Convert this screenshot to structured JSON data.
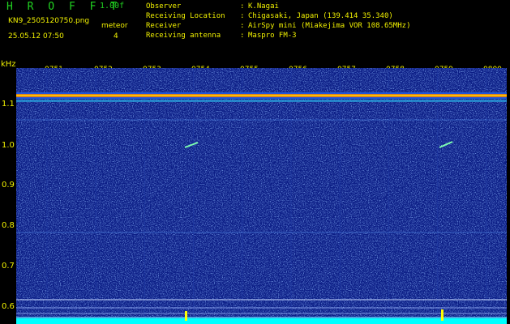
{
  "header": {
    "brand": "H R O F F T",
    "version": "1.00f",
    "filename": "KN9_2505120750.png",
    "datetime": "25.05.12 07:50",
    "meteor_label": "meteor",
    "meteor_count": "4"
  },
  "info": [
    {
      "key": "Observer",
      "sep": ":",
      "value": "K.Nagai"
    },
    {
      "key": "Receiving Location",
      "sep": ":",
      "value": "Chigasaki, Japan (139.414 35.340)"
    },
    {
      "key": "Receiver",
      "sep": ":",
      "value": "AirSpy mini (Miakejima VOR 108.65MHz)"
    },
    {
      "key": "Receiving antenna",
      "sep": ":",
      "value": "Maspro FM-3"
    }
  ],
  "spectrogram": {
    "freq_unit": "kHz",
    "time_labels": [
      "0751",
      "0752",
      "0753",
      "0754",
      "0755",
      "0756",
      "0757",
      "0758",
      "0759",
      "0800"
    ],
    "freq_labels": [
      "1.1",
      "1.0",
      "0.9",
      "0.8",
      "0.7",
      "0.6"
    ],
    "background_color": "#0c1e86",
    "carrier_color": "#ff7f00",
    "noise_floor_color": "#00ffff",
    "text_color": "#f0f000"
  }
}
